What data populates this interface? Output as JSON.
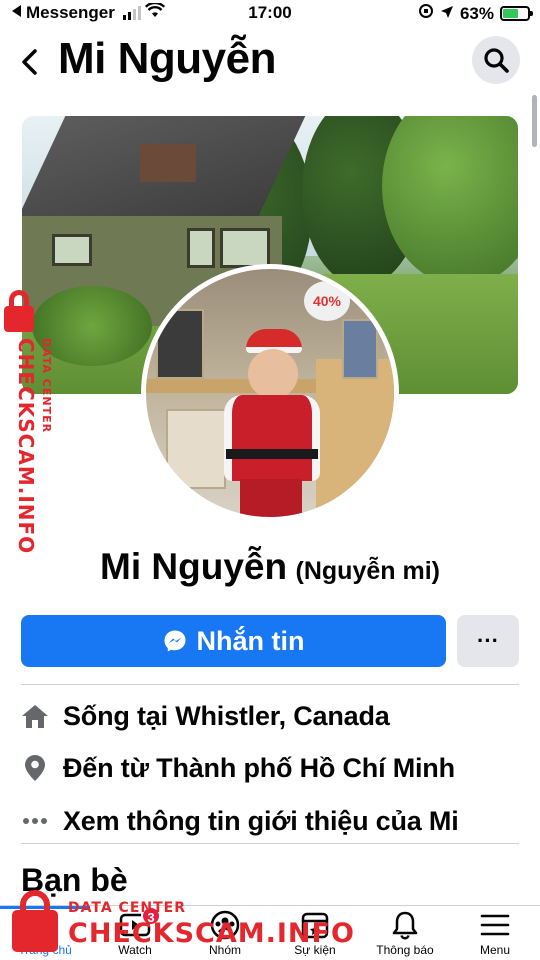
{
  "status_bar": {
    "carrier": "Messenger",
    "time": "17:00",
    "battery_percent": "63%",
    "battery_level": 0.63
  },
  "header": {
    "title": "Mi Nguyễn"
  },
  "profile": {
    "name": "Mi Nguyễn",
    "alternate_name": "(Nguyễn mi)",
    "message_button_label": "Nhắn tin",
    "more_button_label": "···"
  },
  "info": [
    {
      "icon": "home-icon",
      "text": "Sống tại Whistler, Canada"
    },
    {
      "icon": "location-pin-icon",
      "text": "Đến từ Thành phố Hồ Chí Minh"
    },
    {
      "icon": "more-dots-icon",
      "text": "Xem thông tin giới thiệu của Mi"
    }
  ],
  "avatar_sign": "40%",
  "sections": {
    "friends_title": "Bạn bè"
  },
  "bottom_nav": [
    {
      "label": "Trang chủ",
      "icon": "home-nav-icon",
      "active": true
    },
    {
      "label": "Watch",
      "icon": "watch-icon",
      "badge": "3"
    },
    {
      "label": "Nhóm",
      "icon": "groups-icon"
    },
    {
      "label": "Sự kiện",
      "icon": "events-icon"
    },
    {
      "label": "Thông báo",
      "icon": "bell-icon"
    },
    {
      "label": "Menu",
      "icon": "menu-icon"
    }
  ],
  "watermark": {
    "brand": "CHECKSCAM.INFO",
    "tagline": "DATA CENTER"
  },
  "colors": {
    "accent": "#1877f2",
    "secondary_button": "#e4e6eb",
    "badge": "#e41e3f",
    "watermark": "#e4262d"
  }
}
